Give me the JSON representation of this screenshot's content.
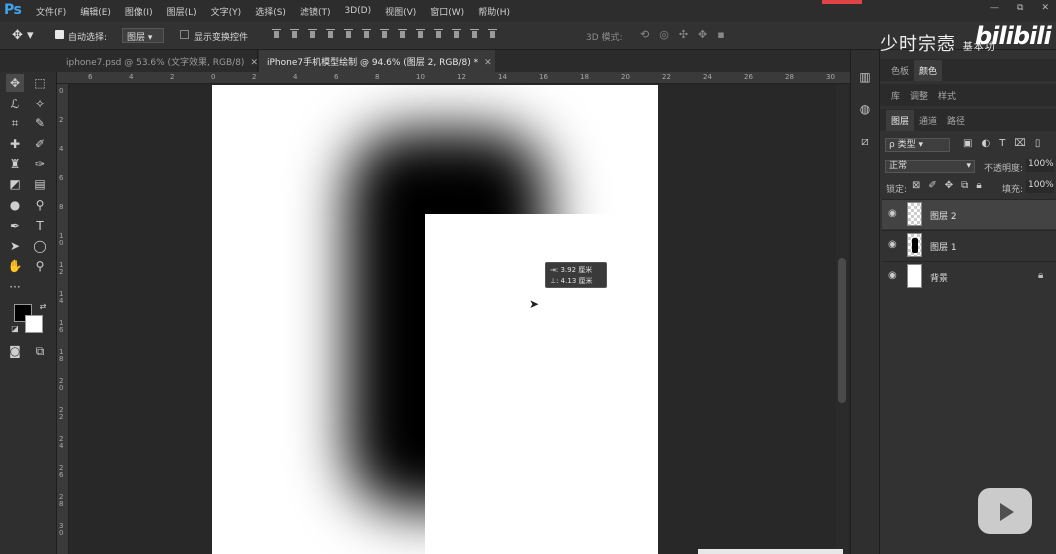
{
  "app": {
    "logo": "Ps",
    "menus": [
      "文件(F)",
      "编辑(E)",
      "图像(I)",
      "图层(L)",
      "文字(Y)",
      "选择(S)",
      "滤镜(T)",
      "3D(D)",
      "视图(V)",
      "窗口(W)",
      "帮助(H)"
    ],
    "window_controls": [
      "—",
      "⧉",
      "✕"
    ]
  },
  "options": {
    "auto_select_label": "自动选择:",
    "auto_select_checked": true,
    "layer_select_value": "图层",
    "show_transform_label": "显示变换控件",
    "mode_3d_label": "3D 模式:"
  },
  "tabs": [
    {
      "label": "iphone7.psd @ 53.6% (文字效果, RGB/8)",
      "active": false
    },
    {
      "label": "iPhone7手机模型绘制 @ 94.6% (图层 2, RGB/8) *",
      "active": true
    }
  ],
  "ruler": {
    "h_labels": [
      "6",
      "4",
      "2",
      "0",
      "2",
      "4",
      "6",
      "8",
      "10",
      "12",
      "14",
      "16",
      "18",
      "20",
      "22",
      "24",
      "26",
      "28",
      "30"
    ],
    "v_labels": [
      "0",
      "2",
      "4",
      "6",
      "8",
      "1\n0",
      "1\n2",
      "1\n4",
      "1\n6",
      "1\n8",
      "2\n0",
      "2\n2",
      "2\n4",
      "2\n6",
      "2\n8",
      "3\n0"
    ]
  },
  "tooltip": {
    "line1": "⇥: 3.92 厘米",
    "line2": "⊥: 4.13 厘米"
  },
  "panel": {
    "row1_tabs": [
      "色板",
      "颜色"
    ],
    "row1_active": 1,
    "row2_tabs": [
      "库",
      "调整",
      "样式"
    ],
    "row3_tabs": [
      "图层",
      "通道",
      "路径"
    ],
    "row3_active": 0,
    "kind_select": "ρ 类型",
    "blend_mode": "正常",
    "opacity_label": "不透明度:",
    "opacity_value": "100%",
    "lock_label": "锁定:",
    "fill_label": "填充:",
    "fill_value": "100%",
    "layers": [
      {
        "name": "图层 2",
        "selected": true
      },
      {
        "name": "图层 1",
        "selected": false
      },
      {
        "name": "背景",
        "selected": false
      }
    ]
  },
  "watermark": {
    "text": "少时宗悫",
    "subtext": "基本功",
    "logo": "bilibili"
  }
}
